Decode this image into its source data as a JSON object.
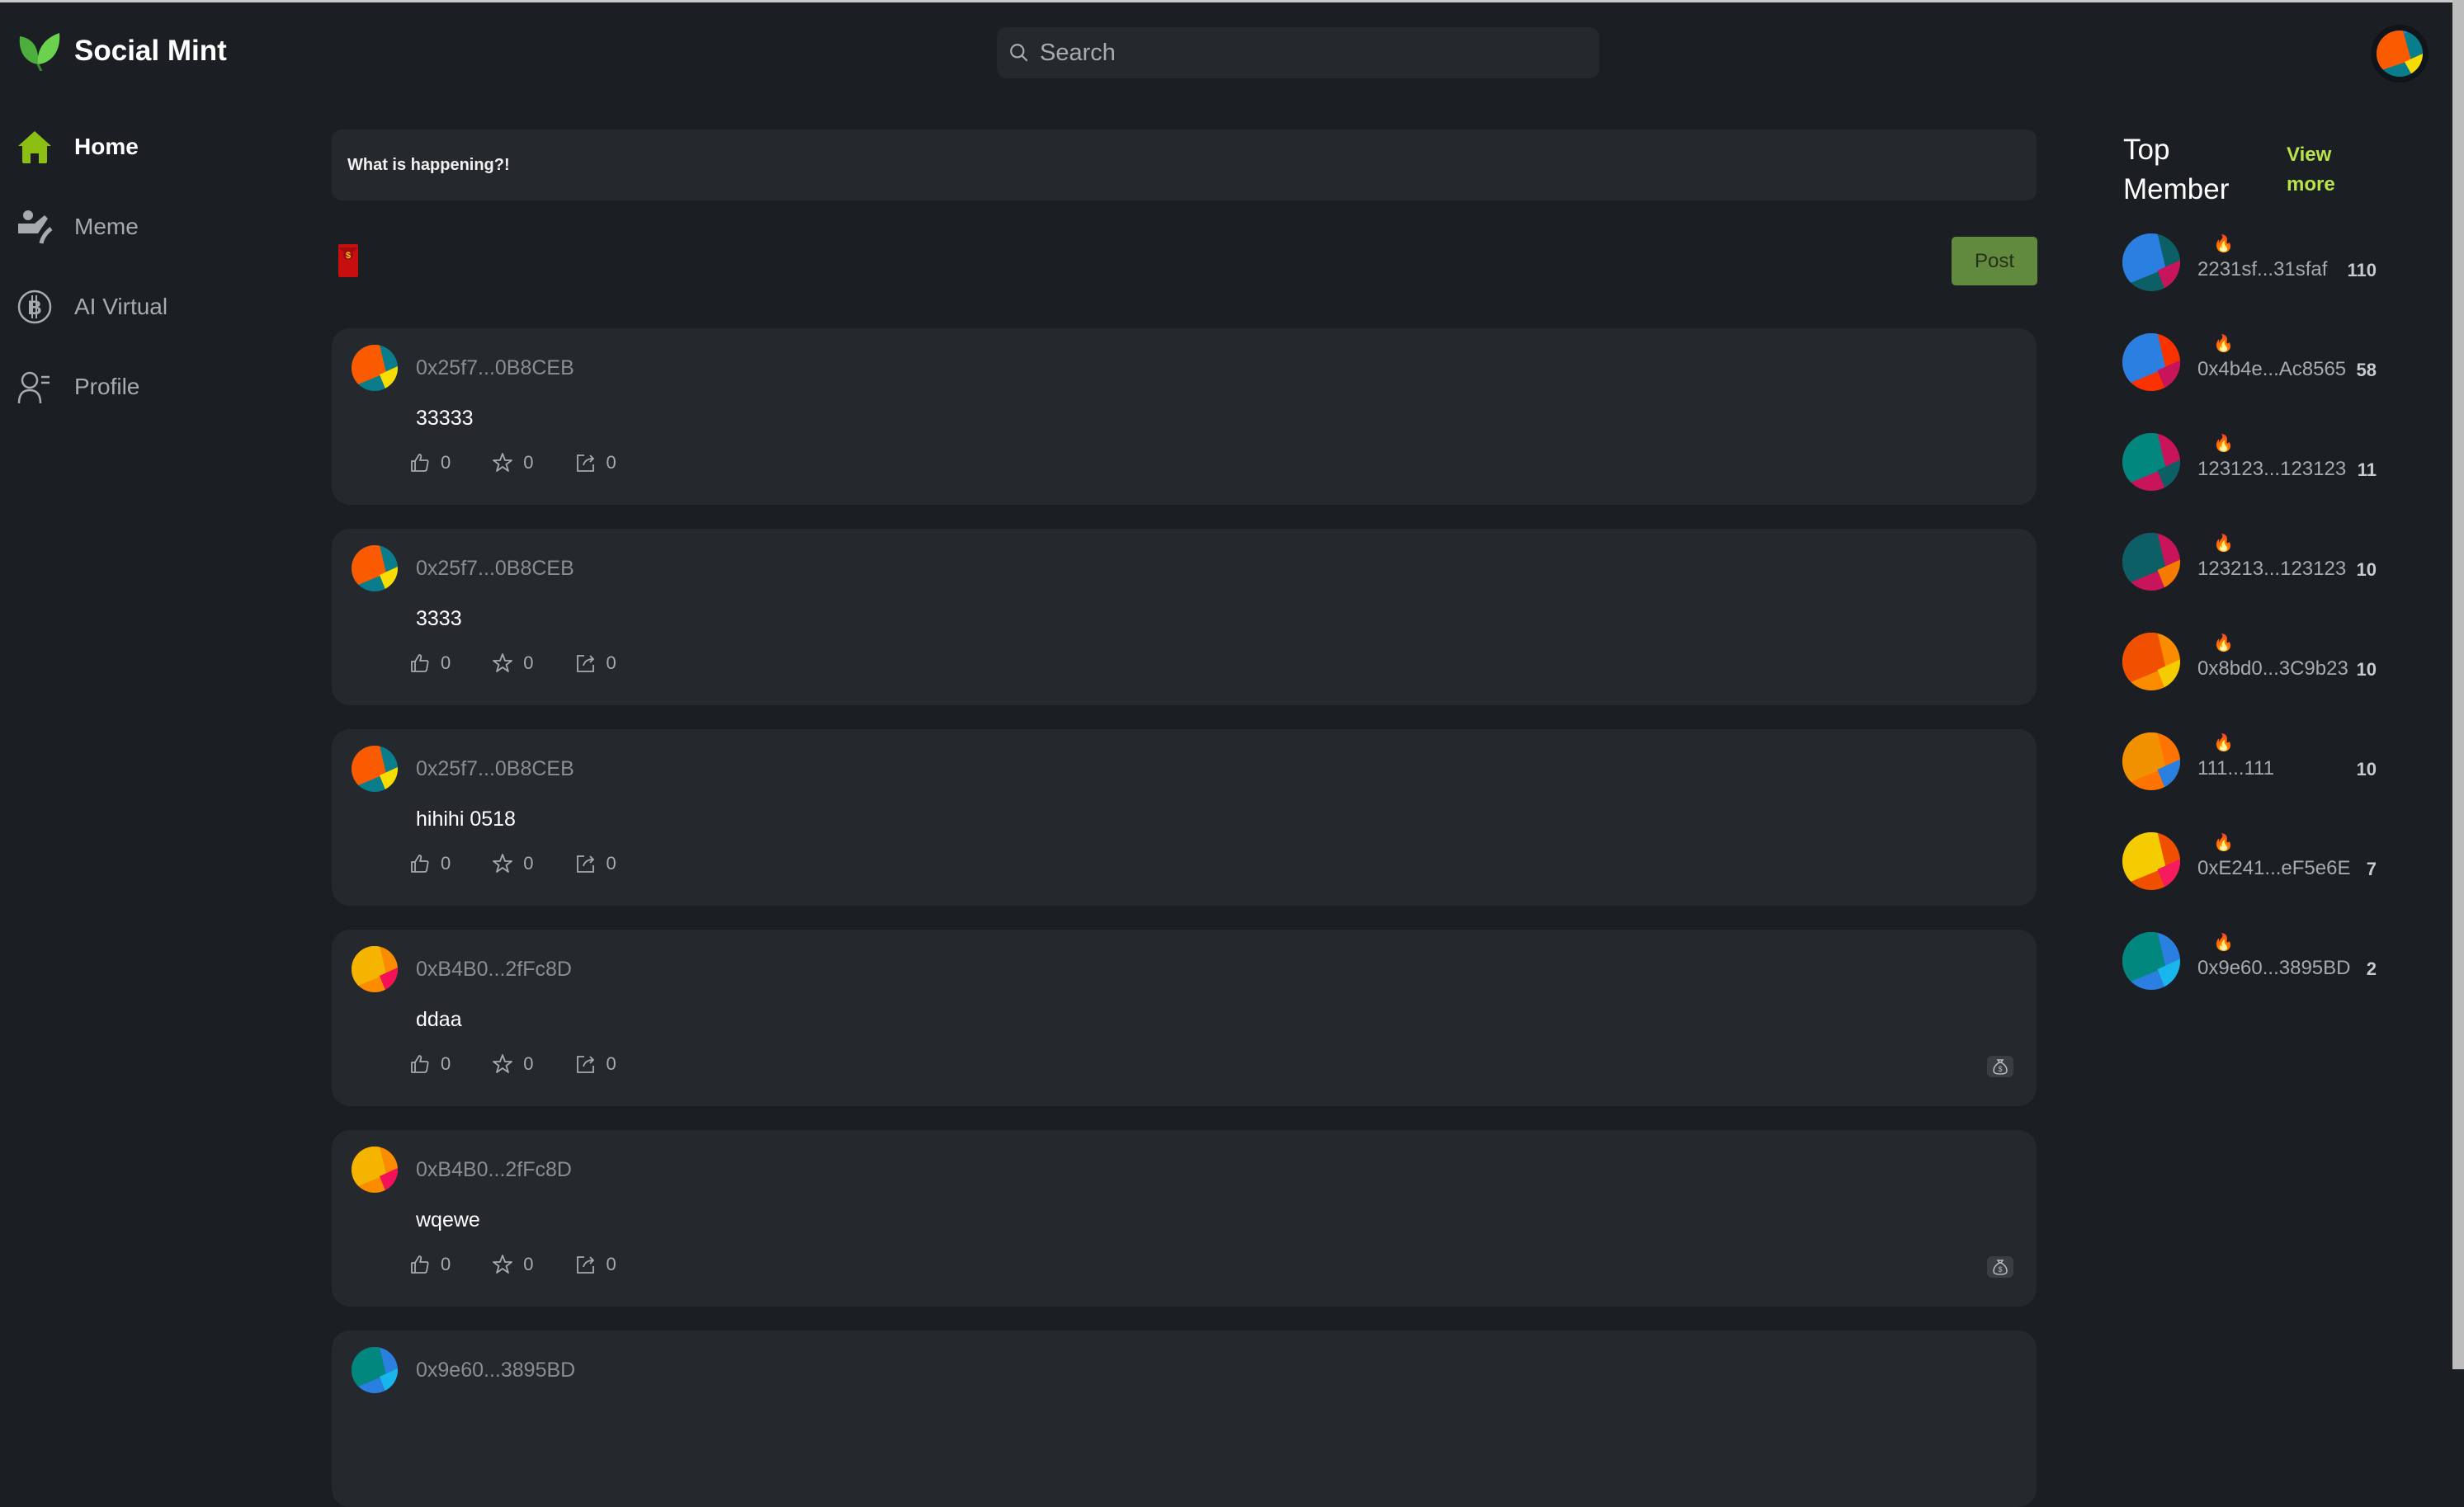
{
  "app": {
    "title": "Social Mint"
  },
  "search": {
    "placeholder": "Search"
  },
  "sidebar": {
    "items": [
      {
        "label": "Home",
        "icon": "home-icon",
        "active": true
      },
      {
        "label": "Meme",
        "icon": "meme-icon",
        "active": false
      },
      {
        "label": "AI Virtual",
        "icon": "bitcoin-icon",
        "active": false
      },
      {
        "label": "Profile",
        "icon": "profile-icon",
        "active": false
      }
    ]
  },
  "composer": {
    "placeholder": "What is happening?!",
    "red_packet_icon": "red-packet-icon",
    "post_label": "Post"
  },
  "posts": [
    {
      "author": "0x25f7...0B8CEB",
      "content": "33333",
      "likes": "0",
      "stars": "0",
      "shares": "0",
      "reward": false
    },
    {
      "author": "0x25f7...0B8CEB",
      "content": "3333",
      "likes": "0",
      "stars": "0",
      "shares": "0",
      "reward": false
    },
    {
      "author": "0x25f7...0B8CEB",
      "content": "hihihi 0518",
      "likes": "0",
      "stars": "0",
      "shares": "0",
      "reward": false
    },
    {
      "author": "0xB4B0...2fFc8D",
      "content": "ddaa",
      "likes": "0",
      "stars": "0",
      "shares": "0",
      "reward": true
    },
    {
      "author": "0xB4B0...2fFc8D",
      "content": "wqewe",
      "likes": "0",
      "stars": "0",
      "shares": "0",
      "reward": true
    },
    {
      "author": "0x9e60...3895BD",
      "content": "",
      "likes": "",
      "stars": "",
      "shares": "",
      "reward": false
    }
  ],
  "top_members": {
    "title": "Top Member",
    "view_more": "View more",
    "members": [
      {
        "address": "2231sf...31sfaf",
        "score": "110"
      },
      {
        "address": "0x4b4e...Ac8565",
        "score": "58"
      },
      {
        "address": "123123...123123",
        "score": "11"
      },
      {
        "address": "123213...123123",
        "score": "10"
      },
      {
        "address": "0x8bd0...3C9b23",
        "score": "10"
      },
      {
        "address": "111...111",
        "score": "10"
      },
      {
        "address": "0xE241...eF5e6E",
        "score": "7"
      },
      {
        "address": "0x9e60...3895BD",
        "score": "2"
      }
    ]
  },
  "colors": {
    "background": "#1b1f23",
    "card": "#25292d",
    "accent": "#8cbe14",
    "post_button": "#628a3f",
    "view_more": "#b9e34a"
  }
}
